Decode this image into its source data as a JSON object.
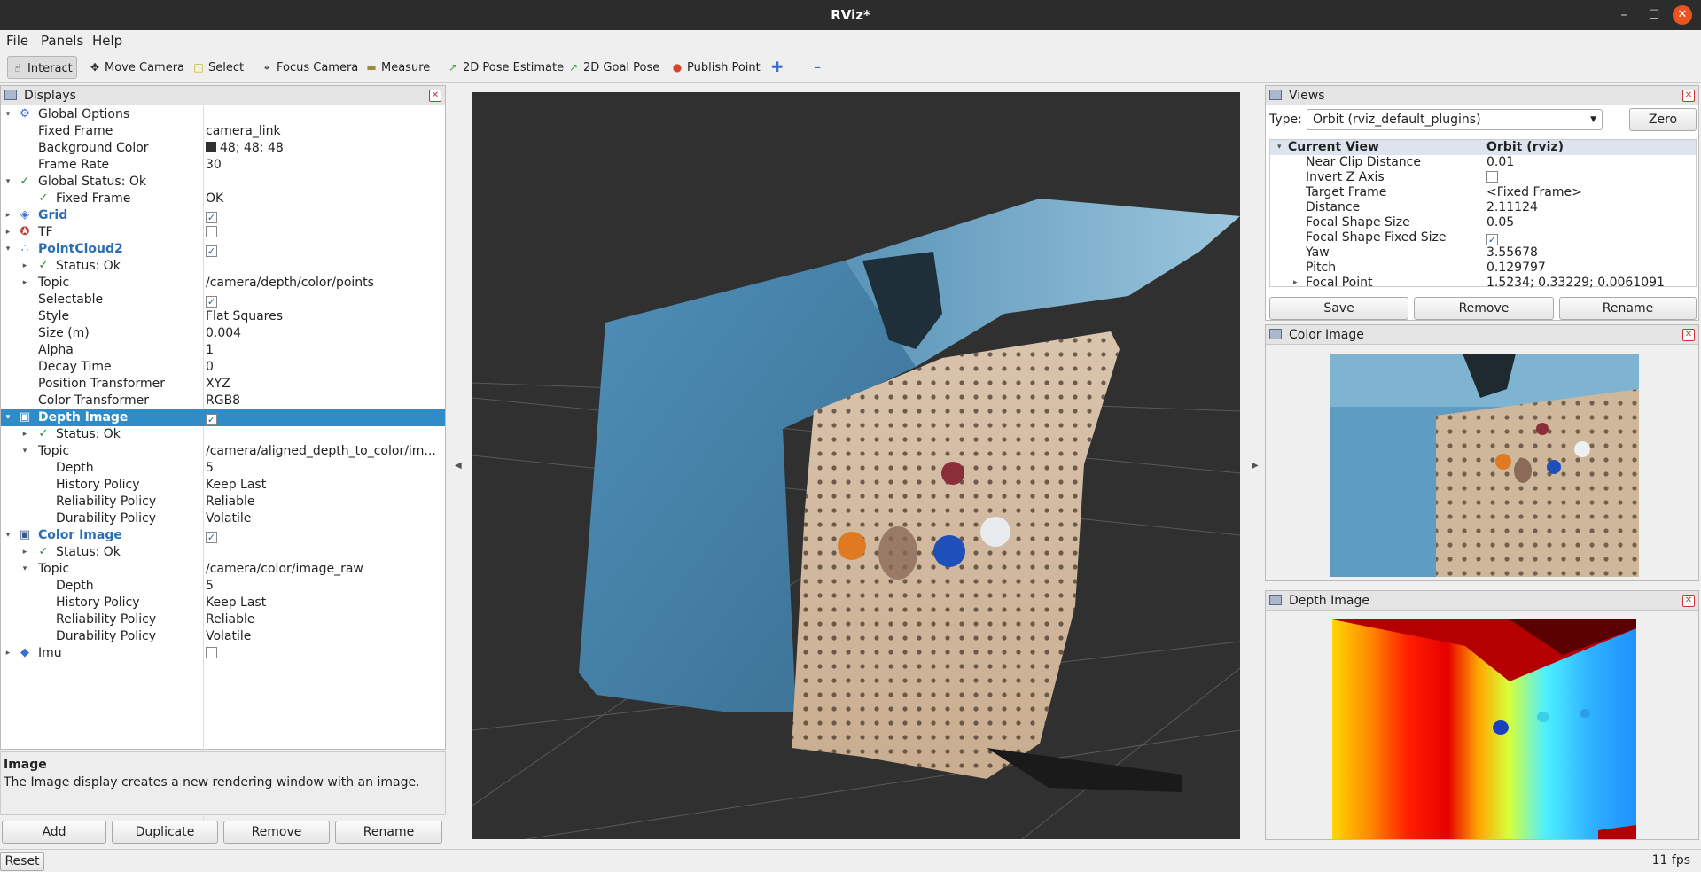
{
  "window": {
    "title": "RViz*"
  },
  "menu": [
    "File",
    "Panels",
    "Help"
  ],
  "toolbar": {
    "interact": "Interact",
    "move_camera": "Move Camera",
    "select": "Select",
    "focus_camera": "Focus Camera",
    "measure": "Measure",
    "pose_estimate": "2D Pose Estimate",
    "goal_pose": "2D Goal Pose",
    "publish_point": "Publish Point"
  },
  "displays": {
    "title": "Displays",
    "rows": [
      {
        "name": "Global Options",
        "value": ""
      },
      {
        "name": "Fixed Frame",
        "value": "camera_link"
      },
      {
        "name": "Background Color",
        "value": "48; 48; 48"
      },
      {
        "name": "Frame Rate",
        "value": "30"
      },
      {
        "name": "Global Status: Ok",
        "value": ""
      },
      {
        "name": "Fixed Frame",
        "value": "OK"
      },
      {
        "name": "Grid",
        "value": ""
      },
      {
        "name": "TF",
        "value": ""
      },
      {
        "name": "PointCloud2",
        "value": ""
      },
      {
        "name": "Status: Ok",
        "value": ""
      },
      {
        "name": "Topic",
        "value": "/camera/depth/color/points"
      },
      {
        "name": "Selectable",
        "value": ""
      },
      {
        "name": "Style",
        "value": "Flat Squares"
      },
      {
        "name": "Size (m)",
        "value": "0.004"
      },
      {
        "name": "Alpha",
        "value": "1"
      },
      {
        "name": "Decay Time",
        "value": "0"
      },
      {
        "name": "Position Transformer",
        "value": "XYZ"
      },
      {
        "name": "Color Transformer",
        "value": "RGB8"
      },
      {
        "name": "Depth Image",
        "value": ""
      },
      {
        "name": "Status: Ok",
        "value": ""
      },
      {
        "name": "Topic",
        "value": "/camera/aligned_depth_to_color/im..."
      },
      {
        "name": "Depth",
        "value": "5"
      },
      {
        "name": "History Policy",
        "value": "Keep Last"
      },
      {
        "name": "Reliability Policy",
        "value": "Reliable"
      },
      {
        "name": "Durability Policy",
        "value": "Volatile"
      },
      {
        "name": "Color Image",
        "value": ""
      },
      {
        "name": "Status: Ok",
        "value": ""
      },
      {
        "name": "Topic",
        "value": "/camera/color/image_raw"
      },
      {
        "name": "Depth",
        "value": "5"
      },
      {
        "name": "History Policy",
        "value": "Keep Last"
      },
      {
        "name": "Reliability Policy",
        "value": "Reliable"
      },
      {
        "name": "Durability Policy",
        "value": "Volatile"
      },
      {
        "name": "Imu",
        "value": ""
      }
    ]
  },
  "description": {
    "title": "Image",
    "text": "The Image display creates a new rendering window with an image."
  },
  "display_buttons": {
    "add": "Add",
    "duplicate": "Duplicate",
    "remove": "Remove",
    "rename": "Rename"
  },
  "views": {
    "title": "Views",
    "type_label": "Type:",
    "type_value": "Orbit (rviz_default_plugins)",
    "zero": "Zero",
    "head_name": "Current View",
    "head_value": "Orbit (rviz)",
    "props": [
      {
        "name": "Near Clip Distance",
        "value": "0.01"
      },
      {
        "name": "Invert Z Axis",
        "value": ""
      },
      {
        "name": "Target Frame",
        "value": "<Fixed Frame>"
      },
      {
        "name": "Distance",
        "value": "2.11124"
      },
      {
        "name": "Focal Shape Size",
        "value": "0.05"
      },
      {
        "name": "Focal Shape Fixed Size",
        "value": ""
      },
      {
        "name": "Yaw",
        "value": "3.55678"
      },
      {
        "name": "Pitch",
        "value": "0.129797"
      },
      {
        "name": "Focal Point",
        "value": "1.5234; 0.33229; 0.0061091"
      }
    ],
    "save": "Save",
    "remove": "Remove",
    "rename": "Rename"
  },
  "color_image": {
    "title": "Color Image"
  },
  "depth_image": {
    "title": "Depth Image"
  },
  "status": {
    "reset": "Reset",
    "fps": "11 fps"
  }
}
